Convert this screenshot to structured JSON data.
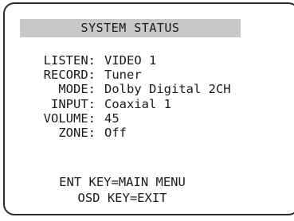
{
  "title": "SYSTEM STATUS",
  "rows": [
    {
      "label": "LISTEN:",
      "value": "VIDEO 1"
    },
    {
      "label": "RECORD:",
      "value": "Tuner"
    },
    {
      "label": "MODE:",
      "value": "Dolby Digital 2CH"
    },
    {
      "label": "INPUT:",
      "value": "Coaxial 1"
    },
    {
      "label": "VOLUME:",
      "value": "45"
    },
    {
      "label": "ZONE:",
      "value": "Off"
    }
  ],
  "footer": {
    "line1": "ENT KEY=MAIN MENU",
    "line2": "OSD KEY=EXIT"
  },
  "colors": {
    "title_bar": "#c8c8c8",
    "text": "#1a1a1a",
    "border": "#2a2a2a",
    "background": "#ffffff"
  }
}
